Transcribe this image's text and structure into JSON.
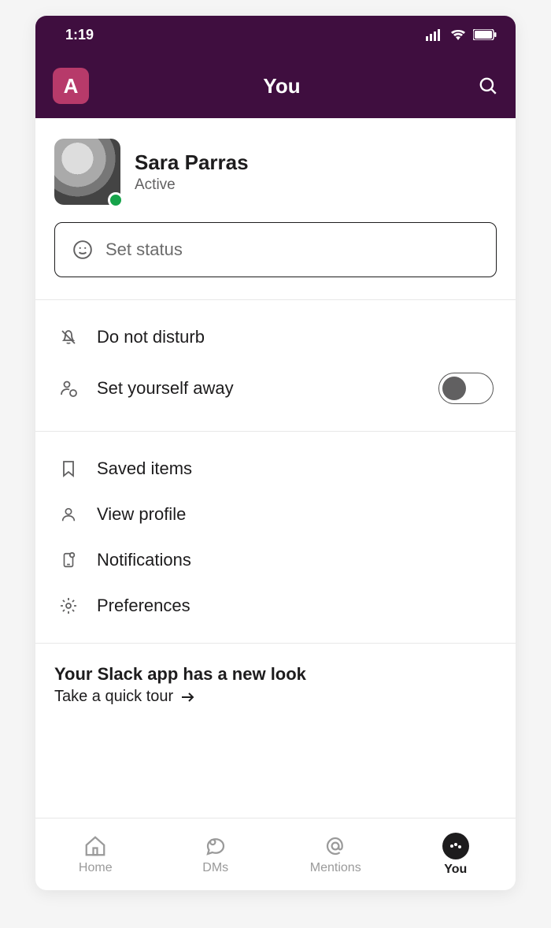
{
  "statusbar": {
    "time": "1:19"
  },
  "header": {
    "workspace_initial": "A",
    "title": "You"
  },
  "profile": {
    "name": "Sara Parras",
    "presence": "Active",
    "presence_color": "#16a34a"
  },
  "status_input": {
    "placeholder": "Set status"
  },
  "section_availability": {
    "dnd": "Do not disturb",
    "away": "Set yourself away",
    "away_toggle_on": false
  },
  "section_settings": {
    "saved": "Saved items",
    "profile": "View profile",
    "notifications": "Notifications",
    "preferences": "Preferences"
  },
  "banner": {
    "title": "Your Slack app has a new look",
    "link": "Take a quick tour"
  },
  "tabs": {
    "home": "Home",
    "dms": "DMs",
    "mentions": "Mentions",
    "you": "You",
    "active": "you"
  }
}
